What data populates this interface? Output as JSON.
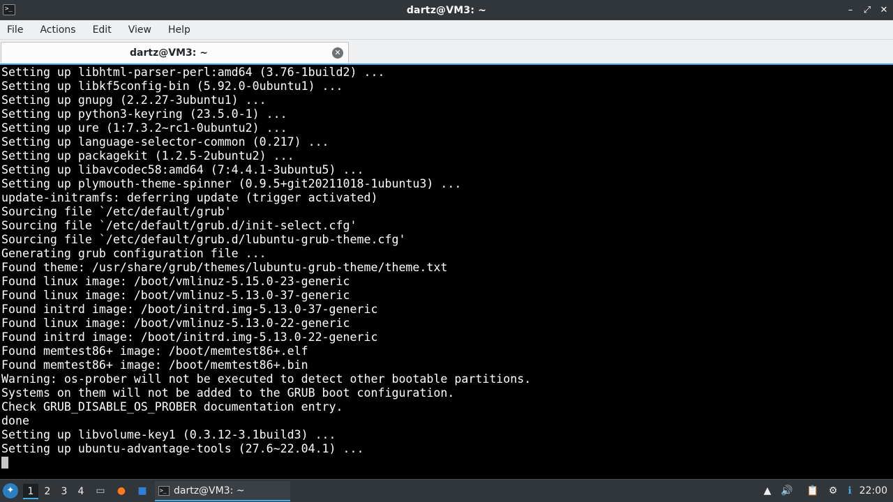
{
  "window": {
    "title": "dartz@VM3: ~",
    "app_icon_glyph": ">_",
    "icons": [
      "terminal-icon",
      "minimize-icon",
      "maximize-icon",
      "close-icon"
    ],
    "minimize_glyph": "–",
    "maximize_glyph": "⤢",
    "close_glyph": "✕"
  },
  "menu": {
    "items": [
      "File",
      "Actions",
      "Edit",
      "View",
      "Help"
    ]
  },
  "tab": {
    "label": "dartz@VM3: ~",
    "close_glyph": "✕"
  },
  "terminal": {
    "lines": [
      "Setting up libhtml-parser-perl:amd64 (3.76-1build2) ...",
      "Setting up libkf5config-bin (5.92.0-0ubuntu1) ...",
      "Setting up gnupg (2.2.27-3ubuntu1) ...",
      "Setting up python3-keyring (23.5.0-1) ...",
      "Setting up ure (1:7.3.2~rc1-0ubuntu2) ...",
      "Setting up language-selector-common (0.217) ...",
      "Setting up packagekit (1.2.5-2ubuntu2) ...",
      "Setting up libavcodec58:amd64 (7:4.4.1-3ubuntu5) ...",
      "Setting up plymouth-theme-spinner (0.9.5+git20211018-1ubuntu3) ...",
      "update-initramfs: deferring update (trigger activated)",
      "Sourcing file `/etc/default/grub'",
      "Sourcing file `/etc/default/grub.d/init-select.cfg'",
      "Sourcing file `/etc/default/grub.d/lubuntu-grub-theme.cfg'",
      "Generating grub configuration file ...",
      "Found theme: /usr/share/grub/themes/lubuntu-grub-theme/theme.txt",
      "Found linux image: /boot/vmlinuz-5.15.0-23-generic",
      "Found linux image: /boot/vmlinuz-5.13.0-37-generic",
      "Found initrd image: /boot/initrd.img-5.13.0-37-generic",
      "Found linux image: /boot/vmlinuz-5.13.0-22-generic",
      "Found initrd image: /boot/initrd.img-5.13.0-22-generic",
      "Found memtest86+ image: /boot/memtest86+.elf",
      "Found memtest86+ image: /boot/memtest86+.bin",
      "Warning: os-prober will not be executed to detect other bootable partitions.",
      "Systems on them will not be added to the GRUB boot configuration.",
      "Check GRUB_DISABLE_OS_PROBER documentation entry.",
      "done",
      "Setting up libvolume-key1 (0.3.12-3.1build3) ...",
      "Setting up ubuntu-advantage-tools (27.6~22.04.1) ..."
    ]
  },
  "taskbar": {
    "start_glyph": "✦",
    "desktops": [
      "1",
      "2",
      "3",
      "4"
    ],
    "active_desktop": "1",
    "quick_launch": [
      {
        "icon": "file-manager-icon",
        "glyph": "▭",
        "color": "#c9c9c9"
      },
      {
        "icon": "firefox-icon",
        "glyph": "●",
        "color": "#ff7a1a"
      },
      {
        "icon": "show-desktop-icon",
        "glyph": "■",
        "color": "#2f7fd6"
      }
    ],
    "task": {
      "label": "dartz@VM3: ~",
      "icon_glyph": ">_"
    },
    "tray": [
      {
        "icon": "tray-expand-icon",
        "glyph": "▲"
      },
      {
        "icon": "volume-icon",
        "glyph": "🔊"
      },
      {
        "icon": "clipboard-icon",
        "glyph": "📋"
      },
      {
        "icon": "network-icon",
        "glyph": "⚙"
      },
      {
        "icon": "update-icon",
        "glyph": "ℹ"
      }
    ],
    "clock": "22:00"
  },
  "colors": {
    "accent": "#3daee9",
    "titlebar": "#31363b",
    "terminal_bg": "#000000",
    "terminal_fg": "#ffffff"
  }
}
